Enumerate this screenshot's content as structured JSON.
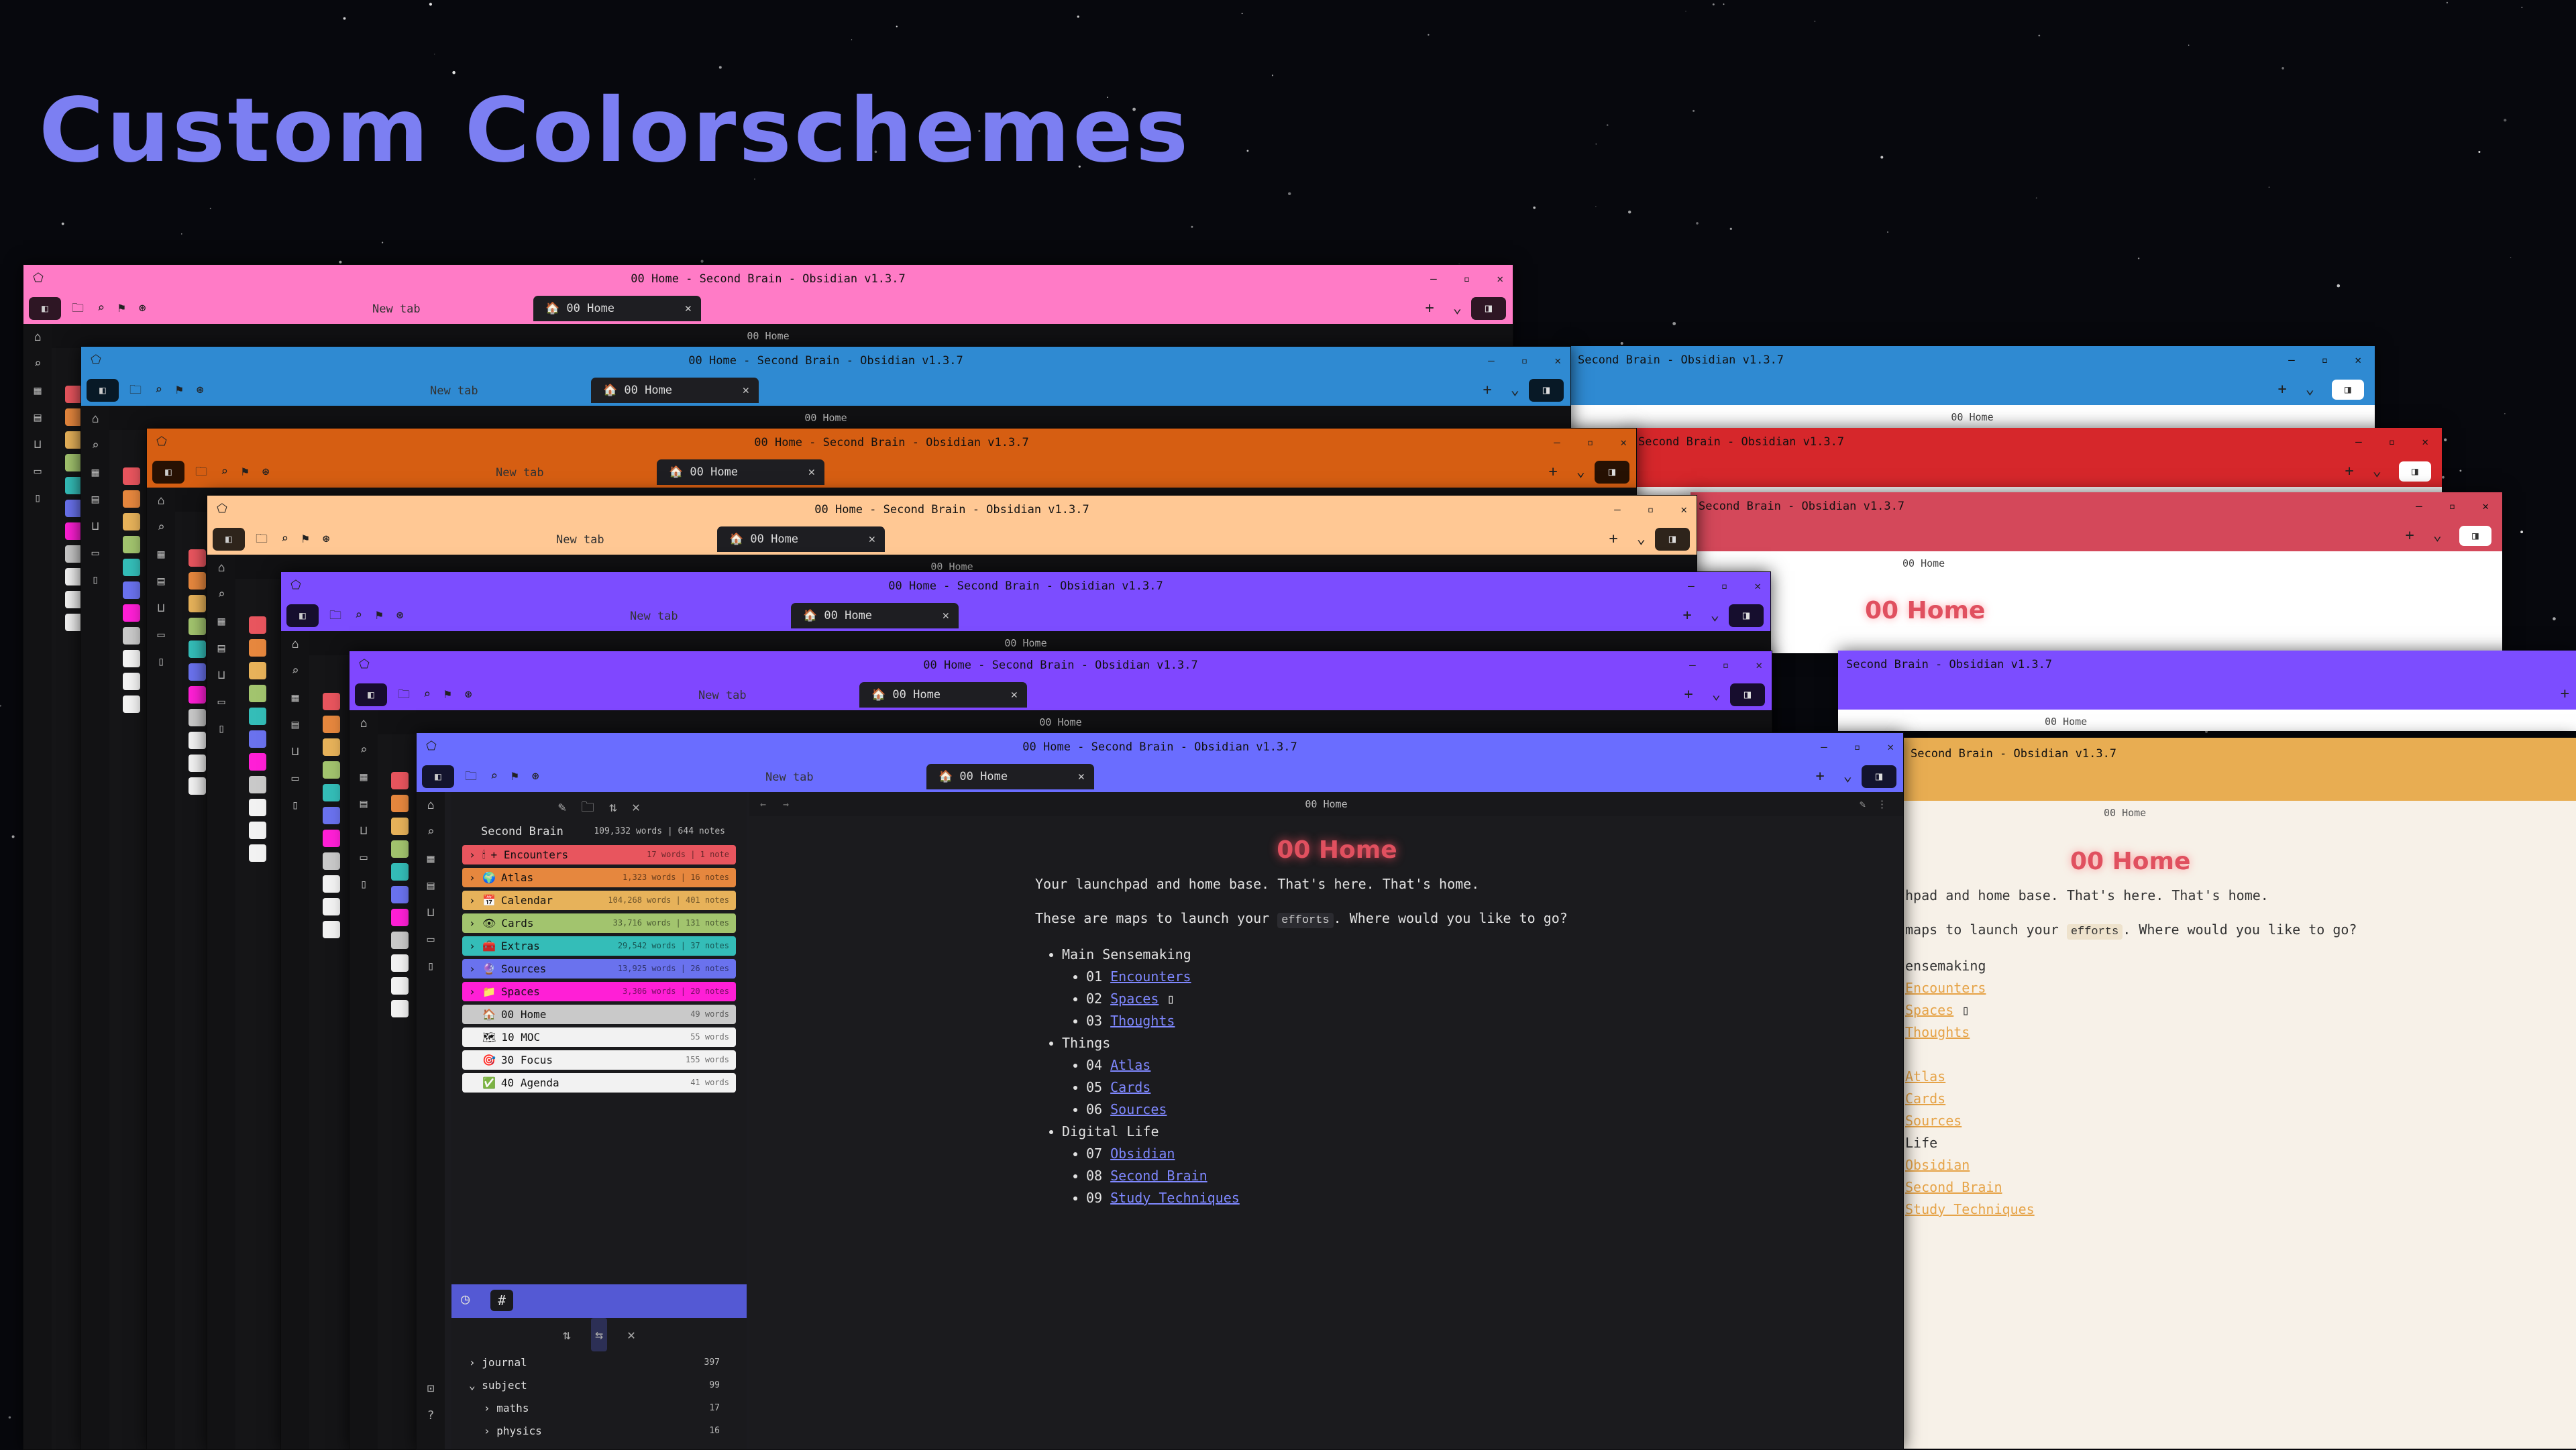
{
  "heading": "Custom Colorschemes",
  "window_title": "00 Home - Second Brain - Obsidian v1.3.7",
  "window_title_short": "Second Brain - Obsidian v1.3.7",
  "new_tab_label": "New tab",
  "active_tab_label": "00 Home",
  "path_label": "00 Home",
  "theme_colors": {
    "pink": "#ff7bc6",
    "blue": "#2f8ad2",
    "orange": "#d65e12",
    "peach": "#ffc894",
    "purple1": "#7c4dff",
    "purple2": "#8047ff",
    "periwinkle": "#6a6dff",
    "red_light": "#d6272b",
    "crimson_light": "#d4485a",
    "gold_light": "#e8ad52"
  },
  "explorer": {
    "vault_name": "Second Brain",
    "vault_meta": "109,332 words | 644 notes",
    "folders": [
      {
        "name": "Encounters",
        "icon": "🕯",
        "prefix": "+",
        "stats": "17 words | 1 note",
        "color": "#e8555e"
      },
      {
        "name": "Atlas",
        "icon": "🌍",
        "stats": "1,323 words | 16 notes",
        "color": "#e6873e"
      },
      {
        "name": "Calendar",
        "icon": "📅",
        "stats": "104,268 words | 401 notes",
        "color": "#e7b25a"
      },
      {
        "name": "Cards",
        "icon": "👁",
        "stats": "33,716 words | 131 notes",
        "color": "#a2c46e"
      },
      {
        "name": "Extras",
        "icon": "🧰",
        "stats": "29,542 words | 37 notes",
        "color": "#34bdb8"
      },
      {
        "name": "Sources",
        "icon": "🔮",
        "stats": "13,925 words | 26 notes",
        "color": "#6a72ee"
      },
      {
        "name": "Spaces",
        "icon": "📁",
        "stats": "3,306 words | 20 notes",
        "color": "#ff1fd6"
      }
    ],
    "notes": [
      {
        "name": "00 Home",
        "icon": "🏠",
        "stats": "49 words",
        "color": "#c9c9c9"
      },
      {
        "name": "10 MOC",
        "icon": "🗺",
        "stats": "55 words",
        "color": "#f2f2f2"
      },
      {
        "name": "30 Focus",
        "icon": "🎯",
        "stats": "155 words",
        "color": "#f2f2f2"
      },
      {
        "name": "40 Agenda",
        "icon": "✅",
        "stats": "41 words",
        "color": "#f2f2f2"
      }
    ]
  },
  "tags": [
    {
      "name": "journal",
      "count": "397",
      "expanded": false,
      "indent": 0
    },
    {
      "name": "subject",
      "count": "99",
      "expanded": true,
      "indent": 0
    },
    {
      "name": "maths",
      "count": "17",
      "expanded": false,
      "indent": 1
    },
    {
      "name": "physics",
      "count": "16",
      "expanded": false,
      "indent": 1
    }
  ],
  "doc": {
    "title": "00 Home",
    "line1": "Your launchpad and home base. That's here. That's home.",
    "line2_pre": "These are maps to launch your ",
    "line2_code": "efforts",
    "line2_post": ". Where would you like to go?",
    "groups": [
      {
        "name": "Main Sensemaking",
        "items": [
          {
            "num": "01",
            "link": "Encounters"
          },
          {
            "num": "02",
            "link": "Spaces",
            "suffix": "▯"
          },
          {
            "num": "03",
            "link": "Thoughts"
          }
        ]
      },
      {
        "name": "Things",
        "items": [
          {
            "num": "04",
            "link": "Atlas"
          },
          {
            "num": "05",
            "link": "Cards"
          },
          {
            "num": "06",
            "link": "Sources"
          }
        ]
      },
      {
        "name": "Digital Life",
        "items": [
          {
            "num": "07",
            "link": "Obsidian"
          },
          {
            "num": "08",
            "link": "Second Brain"
          },
          {
            "num": "09",
            "link": "Study Techniques"
          }
        ]
      }
    ]
  },
  "light_doc": {
    "title": "00 Home",
    "line1": "hpad and home base. That's here. That's home.",
    "line2_pre": "maps to launch your ",
    "line2_code": "efforts",
    "line2_post": ". Where would you like to go?",
    "group1": "ensemaking",
    "group3": "Life",
    "links": [
      "Encounters",
      "Spaces",
      "Thoughts",
      "Atlas",
      "Cards",
      "Sources",
      "Obsidian",
      "Second Brain",
      "Study Techniques"
    ]
  }
}
